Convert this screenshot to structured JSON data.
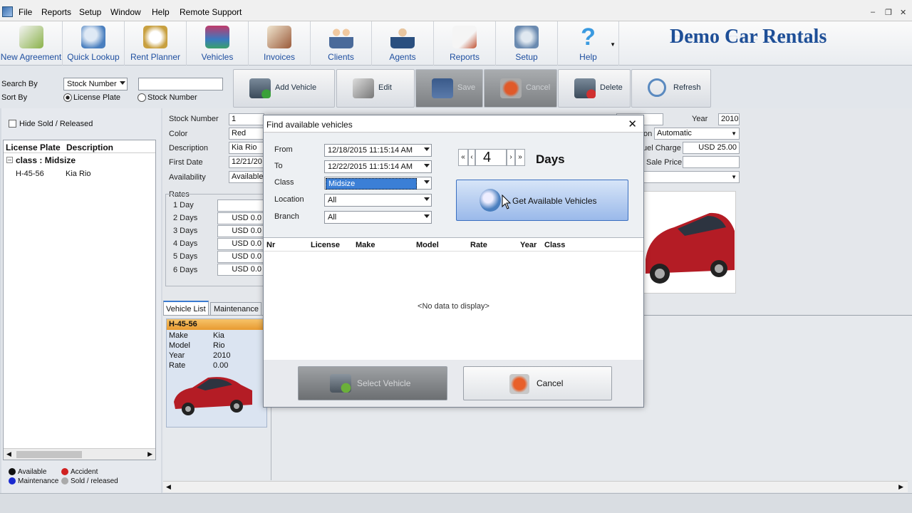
{
  "menu": [
    "File",
    "Reports",
    "Setup",
    "Window",
    "Help",
    "Remote Support"
  ],
  "ribbon": [
    {
      "label": "New Agreement",
      "icon": "agreement-pen-icon",
      "color": "#8ab24a"
    },
    {
      "label": "Quick Lookup",
      "icon": "magnifier-car-icon",
      "color": "#4a7fbf"
    },
    {
      "label": "Rent Planner",
      "icon": "compass-planner-icon",
      "color": "#c8a040"
    },
    {
      "label": "Vehicles",
      "icon": "cars-stack-icon",
      "color": "#3a7ac0"
    },
    {
      "label": "Invoices",
      "icon": "invoice-icon",
      "color": "#9a5a3a"
    },
    {
      "label": "Clients",
      "icon": "clients-group-icon",
      "color": "#4a6a9a"
    },
    {
      "label": "Agents",
      "icon": "agents-icon",
      "color": "#2a4f7f"
    },
    {
      "label": "Reports",
      "icon": "reports-icon",
      "color": "#c05030"
    },
    {
      "label": "Setup",
      "icon": "setup-gear-icon",
      "color": "#6a8ab0"
    },
    {
      "label": "Help",
      "icon": "help-question-icon",
      "color": "#3a9ae0"
    }
  ],
  "brand": "Demo Car Rentals",
  "search": {
    "search_by_label": "Search By",
    "search_by_value": "Stock Number",
    "sort_by_label": "Sort By",
    "sort_opt1": "License Plate",
    "sort_opt2": "Stock Number"
  },
  "toolbar": {
    "add": "Add Vehicle",
    "edit": "Edit",
    "save": "Save",
    "cancel": "Cancel",
    "delete": "Delete",
    "refresh": "Refresh"
  },
  "left": {
    "hide_sold": "Hide Sold / Released",
    "col_plate": "License Plate",
    "col_desc": "Description",
    "group": "class : Midsize",
    "row_plate": "H-45-56",
    "row_desc": "Kia Rio",
    "legend": {
      "available": "Available",
      "accident": "Accident",
      "maintenance": "Maintenance",
      "sold": "Sold / released"
    }
  },
  "form": {
    "stock_label": "Stock Number",
    "stock_value": "1",
    "color_label": "Color",
    "color_value": "Red",
    "desc_label": "Description",
    "desc_value": "Kia Rio",
    "first_date_label": "First Date",
    "first_date_value": "12/21/20",
    "avail_label": "Availability",
    "avail_value": "Available",
    "year_label": "Year",
    "year_value": "2010",
    "trans_label": "on",
    "trans_value": "Automatic",
    "fuel_label": "uel Charge",
    "fuel_value": "USD 25.00",
    "sale_label": "Sale Price",
    "rates_title": "Rates",
    "rates": [
      {
        "label": "1 Day",
        "value": ""
      },
      {
        "label": "2 Days",
        "value": "USD 0.0"
      },
      {
        "label": "3 Days",
        "value": "USD 0.0"
      },
      {
        "label": "4 Days",
        "value": "USD 0.0"
      },
      {
        "label": "5 Days",
        "value": "USD 0.0"
      },
      {
        "label": "6 Days",
        "value": "USD 0.0"
      }
    ],
    "tabs": [
      "Vehicle List",
      "Maintenance"
    ],
    "card": {
      "plate": "H-45-56",
      "make_l": "Make",
      "make": "Kia",
      "model_l": "Model",
      "model": "Rio",
      "year_l": "Year",
      "year": "2010",
      "rate_l": "Rate",
      "rate": "0.00"
    }
  },
  "dialog": {
    "title": "Find available vehicles",
    "from_label": "From",
    "from_value": "12/18/2015 11:15:14 AM",
    "to_label": "To",
    "to_value": "12/22/2015 11:15:14 AM",
    "class_label": "Class",
    "class_value": "Midsize",
    "location_label": "Location",
    "location_value": "All",
    "branch_label": "Branch",
    "branch_value": "All",
    "days_value": "4",
    "days_label": "Days",
    "get_button": "Get Available Vehicles",
    "columns": [
      "Nr",
      "License",
      "Make",
      "Model",
      "Rate",
      "Year",
      "Class"
    ],
    "empty": "<No data to display>",
    "select_button": "Select Vehicle",
    "cancel_button": "Cancel"
  }
}
